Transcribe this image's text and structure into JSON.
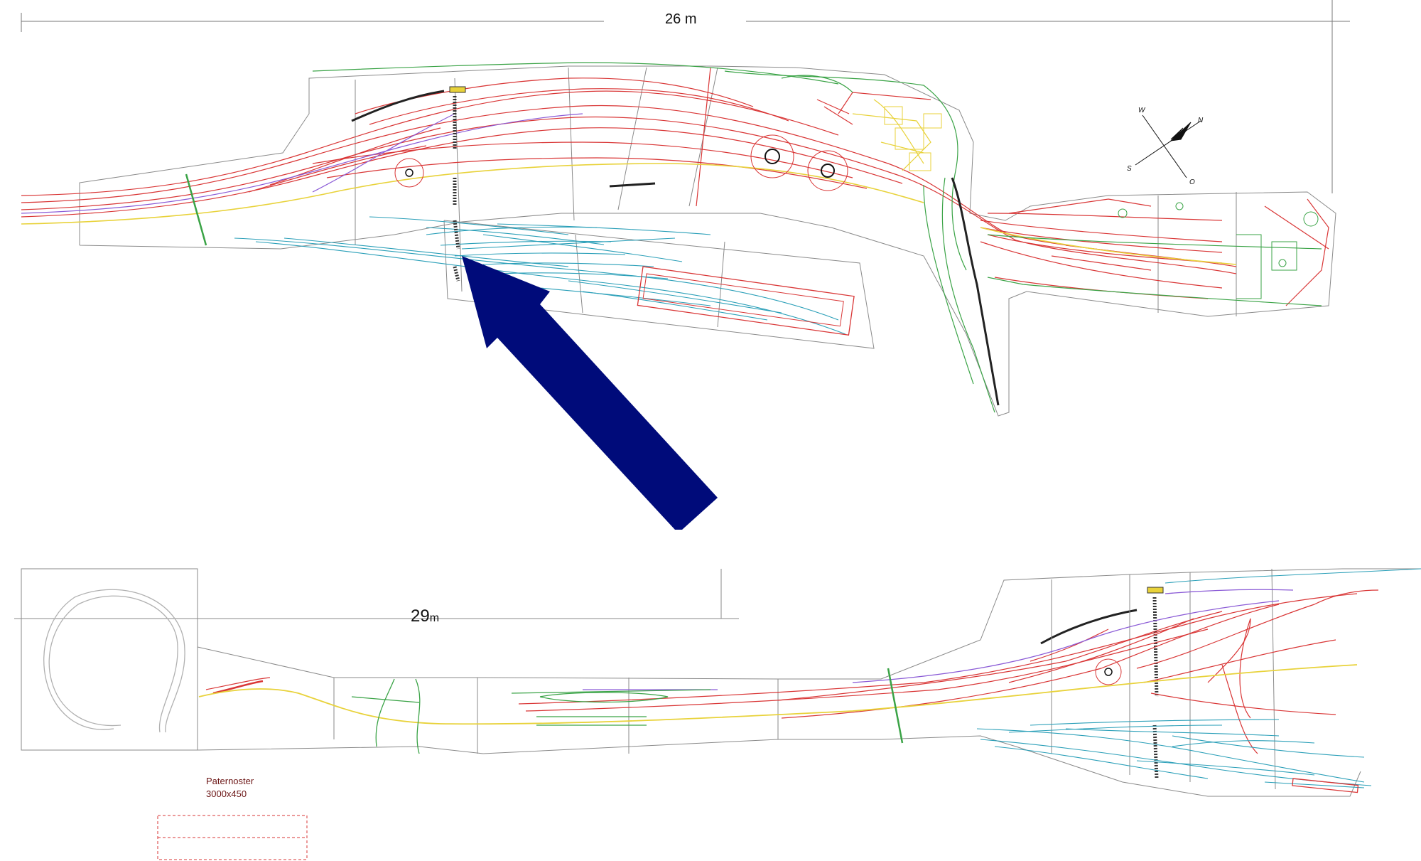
{
  "dimensions": {
    "top_length_value": "26",
    "top_length_unit": "m",
    "bottom_length_value": "29",
    "bottom_length_unit": "m"
  },
  "compass": {
    "north": "N",
    "south": "S",
    "west": "W",
    "east": "O"
  },
  "paternoster": {
    "name": "Paternoster",
    "size": "3000x450"
  },
  "colors": {
    "main_track": "#d93636",
    "yard_track": "#2a9fb8",
    "green_track": "#3aa346",
    "yellow_track": "#e8d23a",
    "purple_track": "#8a5ad6",
    "outline": "#8a8a8a",
    "arrow": "#000b7a",
    "text_dark": "#6b1414"
  },
  "icons": [
    "compass-rose-icon",
    "turntable-icon",
    "direction-arrow-icon"
  ]
}
